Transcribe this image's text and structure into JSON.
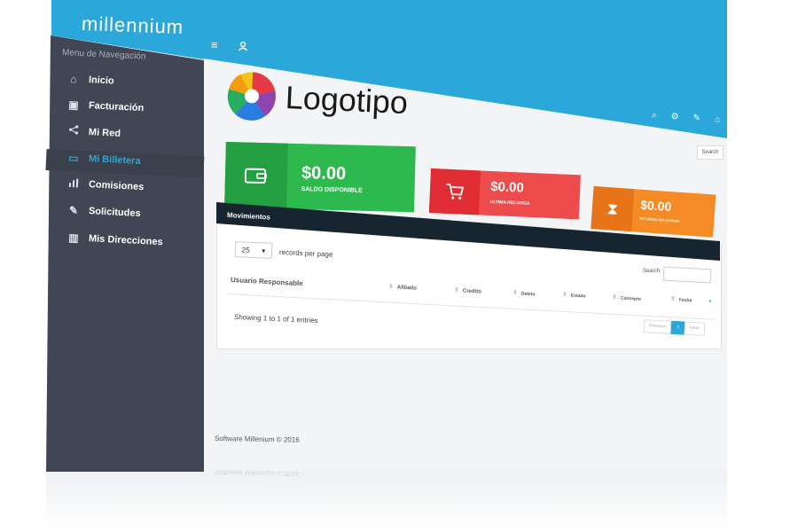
{
  "app": {
    "brand": "millennium"
  },
  "sidebar": {
    "heading": "Menu de Navegación",
    "items": [
      {
        "label": "Inicio",
        "icon": "home-icon"
      },
      {
        "label": "Facturación",
        "icon": "box-icon"
      },
      {
        "label": "Mi Red",
        "icon": "share-icon"
      },
      {
        "label": "Mi Billetera",
        "icon": "wallet-icon",
        "active": true
      },
      {
        "label": "Comisiones",
        "icon": "bar-chart-icon"
      },
      {
        "label": "Solicitudes",
        "icon": "edit-icon"
      },
      {
        "label": "Mis Direcciones",
        "icon": "map-icon"
      }
    ]
  },
  "header": {
    "logo_text": "Logotipo",
    "search_label": "Search",
    "icons": [
      "search-icon",
      "settings-icon",
      "pencil-icon",
      "home-icon",
      "logout-icon"
    ]
  },
  "cards": [
    {
      "value": "$0.00",
      "label": "SALDO DISPONIBLE",
      "color": "#2db94d",
      "icon_color": "#24a043",
      "icon": "wallet-icon"
    },
    {
      "value": "$0.00",
      "label": "ULTIMA RECARGA",
      "color": "#ee4b4c",
      "icon_color": "#e02c33",
      "icon": "cart-icon"
    },
    {
      "value": "$0.00",
      "label": "RECARGA SOLICITADA",
      "color": "#f58b24",
      "icon_color": "#e8741a",
      "icon": "hourglass-icon"
    }
  ],
  "movements": {
    "title": "Movimientos",
    "page_size": "25",
    "records_label": "records per page",
    "search_label": "Search:",
    "columns": [
      "Usuario Responsable",
      "Afiliado",
      "Credito",
      "Debito",
      "Estado",
      "Concepto",
      "Fecha"
    ],
    "info": "Showing 1 to 1 of 1 entries",
    "pagination": {
      "previous": "Previous",
      "current": "1",
      "next": "Next"
    }
  },
  "footer": {
    "text": "Software Millenium © 2016"
  },
  "colors": {
    "topbar": "#2ba7d9",
    "sidebar": "#404653",
    "accent": "#2ba7d9"
  }
}
